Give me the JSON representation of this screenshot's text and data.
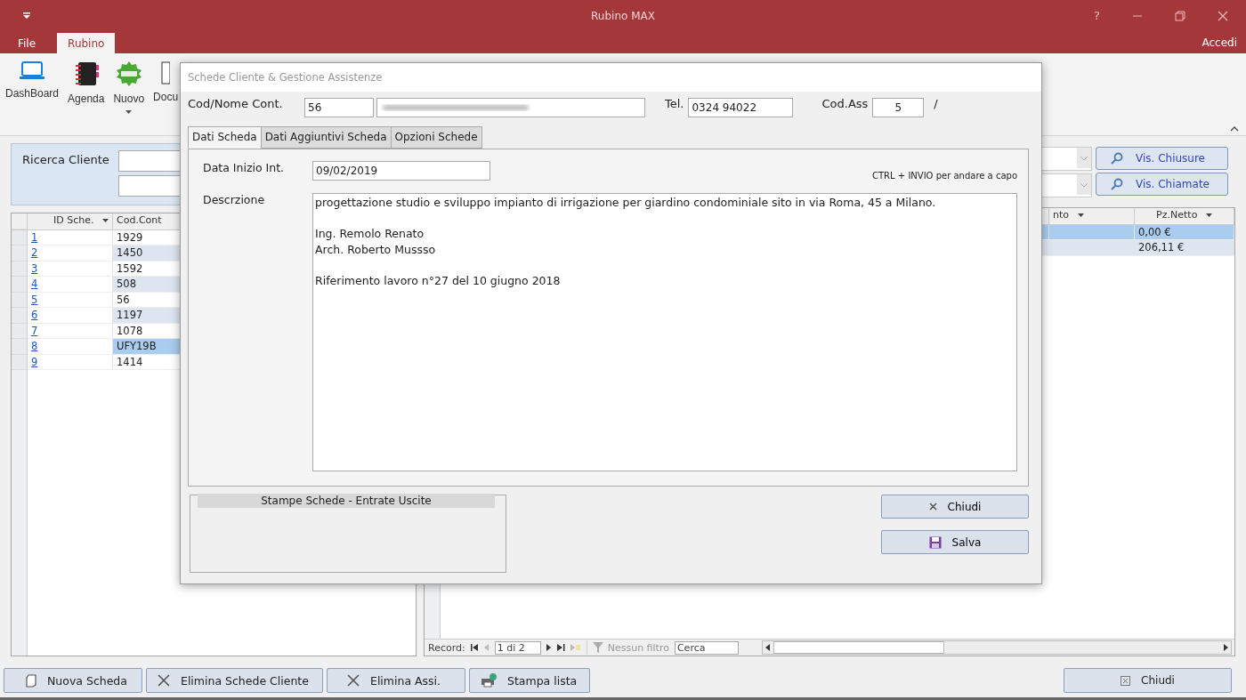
{
  "app": {
    "title": "Rubino MAX",
    "help": "?",
    "account": "Accedi"
  },
  "ribbon_tabs": [
    {
      "label": "File",
      "selected": false
    },
    {
      "label": "Rubino",
      "selected": true
    }
  ],
  "ribbon_buttons": [
    {
      "label": "DashBoard",
      "kind": "laptop",
      "dropdown": false
    },
    {
      "label": "Agenda",
      "kind": "notebook",
      "dropdown": false
    },
    {
      "label": "Nuovo",
      "kind": "new",
      "dropdown": true
    },
    {
      "label": "Docu",
      "kind": "document",
      "dropdown": false
    }
  ],
  "search_panel": {
    "label": "Ricerca Cliente"
  },
  "left_table": {
    "columns": [
      "ID Sche.",
      "Cod.Cont"
    ],
    "rows": [
      {
        "id": "1",
        "code": "1929",
        "selected": false
      },
      {
        "id": "2",
        "code": "1450",
        "selected": false
      },
      {
        "id": "3",
        "code": "1592",
        "selected": false
      },
      {
        "id": "4",
        "code": "508",
        "selected": false
      },
      {
        "id": "5",
        "code": "56",
        "selected": false
      },
      {
        "id": "6",
        "code": "1197",
        "selected": false
      },
      {
        "id": "7",
        "code": "1078",
        "selected": false
      },
      {
        "id": "8",
        "code": "UFY19B",
        "selected": true
      },
      {
        "id": "9",
        "code": "1414",
        "selected": false
      }
    ]
  },
  "right_panel": {
    "buttons": [
      "Vis. Chiusure",
      "Vis. Chiamate"
    ],
    "table": {
      "columns": [
        "nto",
        "Pz.Netto"
      ],
      "rows": [
        {
          "value": "0,00 €",
          "selected": true
        },
        {
          "value": "206,11 €",
          "selected": false
        }
      ]
    },
    "navigation": {
      "label": "Record:",
      "position": "1 di 2",
      "filter": "Nessun filtro",
      "search": "Cerca"
    }
  },
  "bottom_buttons": [
    {
      "label": "Nuova Scheda",
      "kind": "page"
    },
    {
      "label": "Elimina Schede Cliente",
      "kind": "cross"
    },
    {
      "label": "Elimina Assi.",
      "kind": "cross"
    },
    {
      "label": "Stampa lista",
      "kind": "printer"
    }
  ],
  "close_button": {
    "label": "Chiudi"
  },
  "dialog": {
    "title": "Schede Cliente & Gestione Assistenze",
    "contact_label": "Cod/Nome Cont.",
    "contact_code": "56",
    "phone_label": "Tel.",
    "phone": "0324 94022",
    "assist_label": "Cod.Ass",
    "assist_code": "5",
    "separator": "/",
    "tabs": [
      {
        "label": "Dati Scheda",
        "selected": true
      },
      {
        "label": "Dati Aggiuntivi Scheda",
        "selected": false
      },
      {
        "label": "Opzioni Schede",
        "selected": false
      }
    ],
    "date_label": "Data Inizio Int.",
    "date": "09/02/2019",
    "hint": "CTRL + INVIO per andare a capo",
    "description_label": "Descrzione",
    "description": "progettazione studio e sviluppo impianto di irrigazione per giardino condominiale sito in via Roma, 45 a Milano.\n\nIng. Remolo Renato\nArch. Roberto Mussso\n\nRiferimento lavoro n°27 del 10 giugno 2018",
    "print_group": "Stampe Schede - Entrate Uscite",
    "buttons": [
      {
        "label": "Chiudi",
        "kind": "cross"
      },
      {
        "label": "Salva",
        "kind": "floppy"
      }
    ]
  }
}
